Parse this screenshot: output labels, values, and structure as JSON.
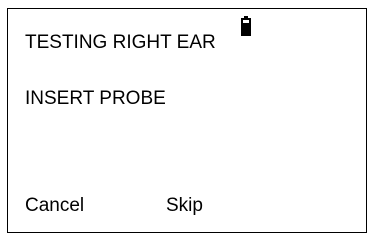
{
  "screen": {
    "title": "TESTING RIGHT EAR",
    "status": "INSERT PROBE",
    "battery_icon": "battery-icon",
    "battery_level": 0.7
  },
  "softkeys": {
    "cancel": "Cancel",
    "skip": "Skip"
  }
}
